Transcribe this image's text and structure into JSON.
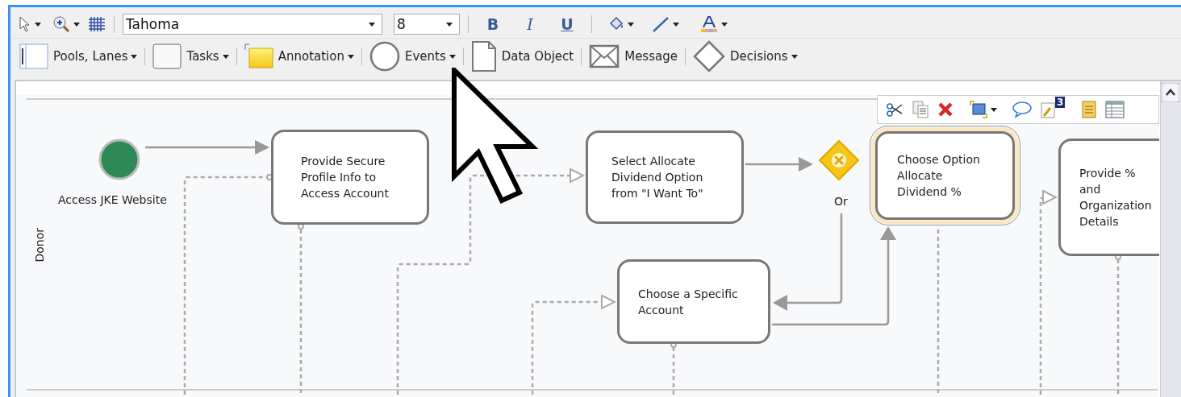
{
  "toolbar": {
    "font": "Tahoma",
    "font_size": "8",
    "format_buttons": [
      "B",
      "I",
      "U"
    ]
  },
  "palette": [
    {
      "kind": "pool",
      "label": "Pools, Lanes",
      "dropdown": true
    },
    {
      "kind": "task",
      "label": "Tasks",
      "dropdown": true
    },
    {
      "kind": "annotation",
      "label": "Annotation",
      "dropdown": true
    },
    {
      "kind": "event",
      "label": "Events",
      "dropdown": true
    },
    {
      "kind": "data",
      "label": "Data Object",
      "dropdown": false
    },
    {
      "kind": "message",
      "label": "Message",
      "dropdown": false
    },
    {
      "kind": "decision",
      "label": "Decisions",
      "dropdown": true
    }
  ],
  "diagram": {
    "lane": "Donor",
    "start_event": {
      "label": "Access JKE Website"
    },
    "gateway": {
      "label": "Or"
    },
    "tasks": [
      {
        "label": "Provide Secure Profile Info to Access Account",
        "selected": false
      },
      {
        "label": "Select Allocate Dividend Option from \"I Want To\"",
        "selected": false
      },
      {
        "label": "Choose Option Allocate Dividend %",
        "selected": true
      },
      {
        "label": "Provide % and Organization Details",
        "selected": false
      },
      {
        "label": "Choose a Specific Account",
        "selected": false
      }
    ]
  },
  "mini_toolbar": {
    "badge": "3"
  }
}
